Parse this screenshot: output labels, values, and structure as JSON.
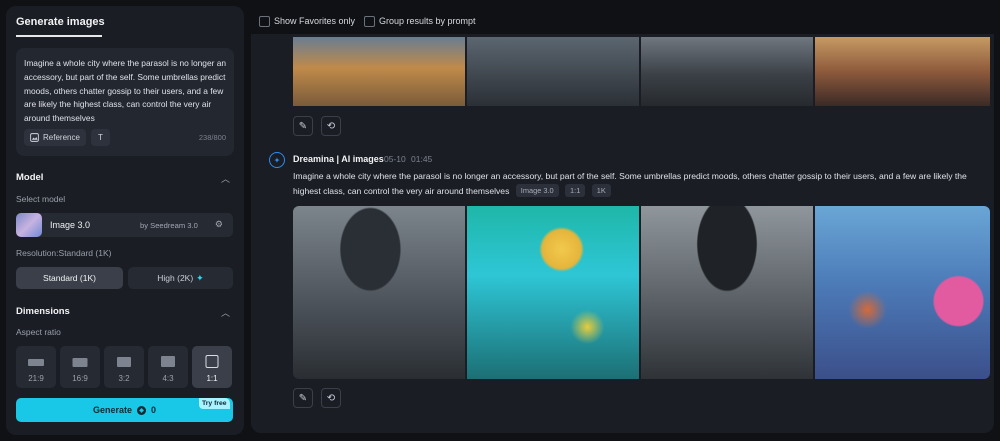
{
  "left_panel": {
    "tab_label": "Generate images",
    "prompt": "Imagine a whole city where the parasol is no longer an accessory, but part of the self. Some umbrellas predict moods, others chatter gossip to their users, and a few are likely the highest class, can control the very air around themselves",
    "reference_label": "Reference",
    "char_count": "238/800",
    "model_section": "Model",
    "select_model_label": "Select model",
    "model_name": "Image 3.0",
    "model_provider": "by Seedream 3.0",
    "resolution_label": "Resolution:Standard (1K)",
    "resolution_standard": "Standard (1K)",
    "resolution_high": "High (2K)",
    "dimensions_section": "Dimensions",
    "aspect_ratio_label": "Aspect ratio",
    "aspect_ratios": [
      "21:9",
      "16:9",
      "3:2",
      "4:3",
      "1:1"
    ],
    "selected_ratio": "1:1",
    "generate_label": "Generate",
    "generate_cost": "0",
    "try_free_label": "Try free"
  },
  "top_bar": {
    "show_favorites": "Show Favorites only",
    "group_by_prompt": "Group results by prompt"
  },
  "generation": {
    "author": "Dreamina | AI images",
    "date": "05-10",
    "time": "01:45",
    "prompt": "Imagine a whole city where the parasol is no longer an accessory, but part of the self. Some umbrellas predict moods, others chatter gossip to their users, and a few are likely the highest class, can control the very air around themselves",
    "tags": [
      "Image 3.0",
      "1:1",
      "1K"
    ]
  },
  "colors": {
    "accent": "#19c7e6",
    "panel": "#1a1d24",
    "background": "#0f1115"
  }
}
